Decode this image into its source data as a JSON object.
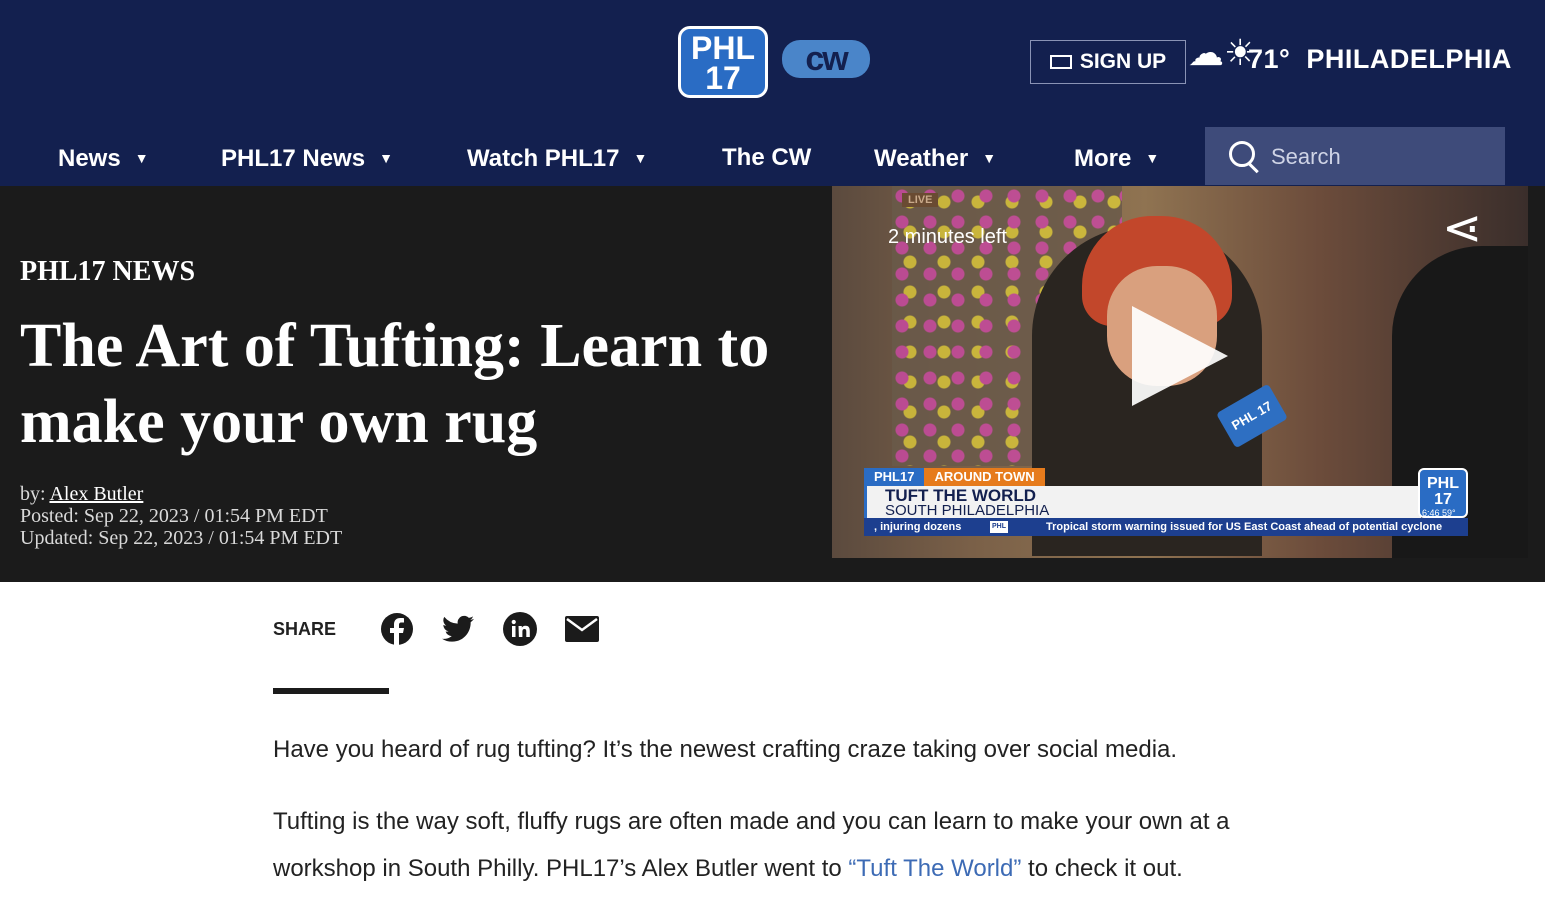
{
  "header": {
    "logo_phl_line1": "PHL",
    "logo_phl_line2": "17",
    "logo_cw": "cw",
    "signup_label": "SIGN UP",
    "weather_icon": "partly-sunny-icon",
    "temperature": "71°",
    "city": "PHILADELPHIA"
  },
  "nav": {
    "items": [
      {
        "label": "News",
        "has_dropdown": true
      },
      {
        "label": "PHL17 News",
        "has_dropdown": true
      },
      {
        "label": "Watch PHL17",
        "has_dropdown": true
      },
      {
        "label": "The CW",
        "has_dropdown": false
      },
      {
        "label": "Weather",
        "has_dropdown": true
      },
      {
        "label": "More",
        "has_dropdown": true
      }
    ],
    "search_placeholder": "Search"
  },
  "article": {
    "kicker": "PHL17 NEWS",
    "title": "The Art of Tufting: Learn to make your own rug",
    "byline_prefix": "by:",
    "author": "Alex Butler",
    "posted": "Posted: Sep 22, 2023 / 01:54 PM EDT",
    "updated": "Updated: Sep 22, 2023 / 01:54 PM EDT"
  },
  "video": {
    "live_tag": "LIVE",
    "time_left": "2 minutes left",
    "lower_third": {
      "tag1": "PHL17",
      "tag2": "AROUND TOWN",
      "title": "TUFT THE WORLD",
      "subtitle": "SOUTH PHILADELPHIA",
      "logo_line1": "PHL",
      "logo_line2": "17",
      "clock": "6:46  59°",
      "ticker_left": ", injuring dozens",
      "ticker_logo": "PHL",
      "ticker_right": "Tropical storm warning issued for US East Coast ahead of potential cyclone"
    },
    "mic_label": "PHL 17"
  },
  "share": {
    "label": "SHARE",
    "icons": [
      "facebook-icon",
      "twitter-icon",
      "linkedin-icon",
      "email-icon"
    ]
  },
  "body": {
    "p1": "Have you heard of rug tufting?  It’s the newest crafting craze taking over social media.",
    "p2_before": "Tufting is the way soft, fluffy rugs are often made and you can learn to make your own at a workshop in South Philly. PHL17’s Alex Butler went to ",
    "p2_link": "“Tuft The World”",
    "p2_after": " to check it out."
  },
  "colors": {
    "header_bg": "#13204f",
    "search_bg": "#3e4b7a",
    "hero_bg": "#1b1b1b",
    "link": "#3d6bb5",
    "accent_blue": "#2a6cc4",
    "accent_orange": "#e67b1c"
  }
}
